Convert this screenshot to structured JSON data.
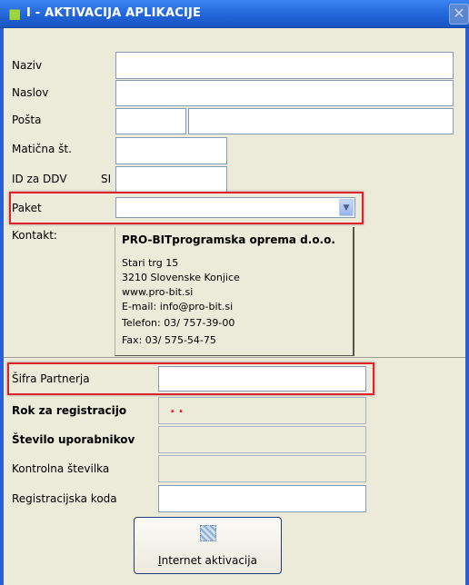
{
  "window": {
    "title": "I - AKTIVACIJA APLIKACIJE"
  },
  "labels": {
    "naziv": "Naziv",
    "naslov": "Naslov",
    "posta": "Pošta",
    "maticna": "Matična št.",
    "id_ddv": "ID za DDV",
    "si_prefix": "SI",
    "paket": "Paket",
    "kontakt": "Kontakt:",
    "sifra": "Šifra Partnerja",
    "rok": "Rok za registracijo",
    "stevilo": "Število uporabnikov",
    "kontrolna": "Kontrolna številka",
    "regkoda": "Registracijska koda"
  },
  "contact": {
    "company": "PRO-BITprogramska oprema d.o.o.",
    "lines": [
      "Stari trg 15",
      "3210 Slovenske Konjice",
      "www.pro-bit.si",
      "E-mail: info@pro-bit.si",
      "Telefon: 03/ 757-39-00",
      "Fax: 03/ 575-54-75"
    ]
  },
  "fields": {
    "naziv": "",
    "naslov": "",
    "posta_code": "",
    "posta_city": "",
    "maticna": "",
    "id_ddv": "",
    "paket": "",
    "sifra": "",
    "rok": "..",
    "stevilo": "",
    "kontrolna": "",
    "regkoda": ""
  },
  "button": {
    "label_first": "I",
    "label_rest": "nternet aktivacija"
  },
  "colors": {
    "highlight_box": "#e0202a",
    "dialog_bg": "#ecead9",
    "titlebar": "#2063d6"
  },
  "icons": {
    "app": "app-icon",
    "close": "close-icon",
    "button": "internet-activation-icon",
    "combo": "chevron-down-icon"
  }
}
